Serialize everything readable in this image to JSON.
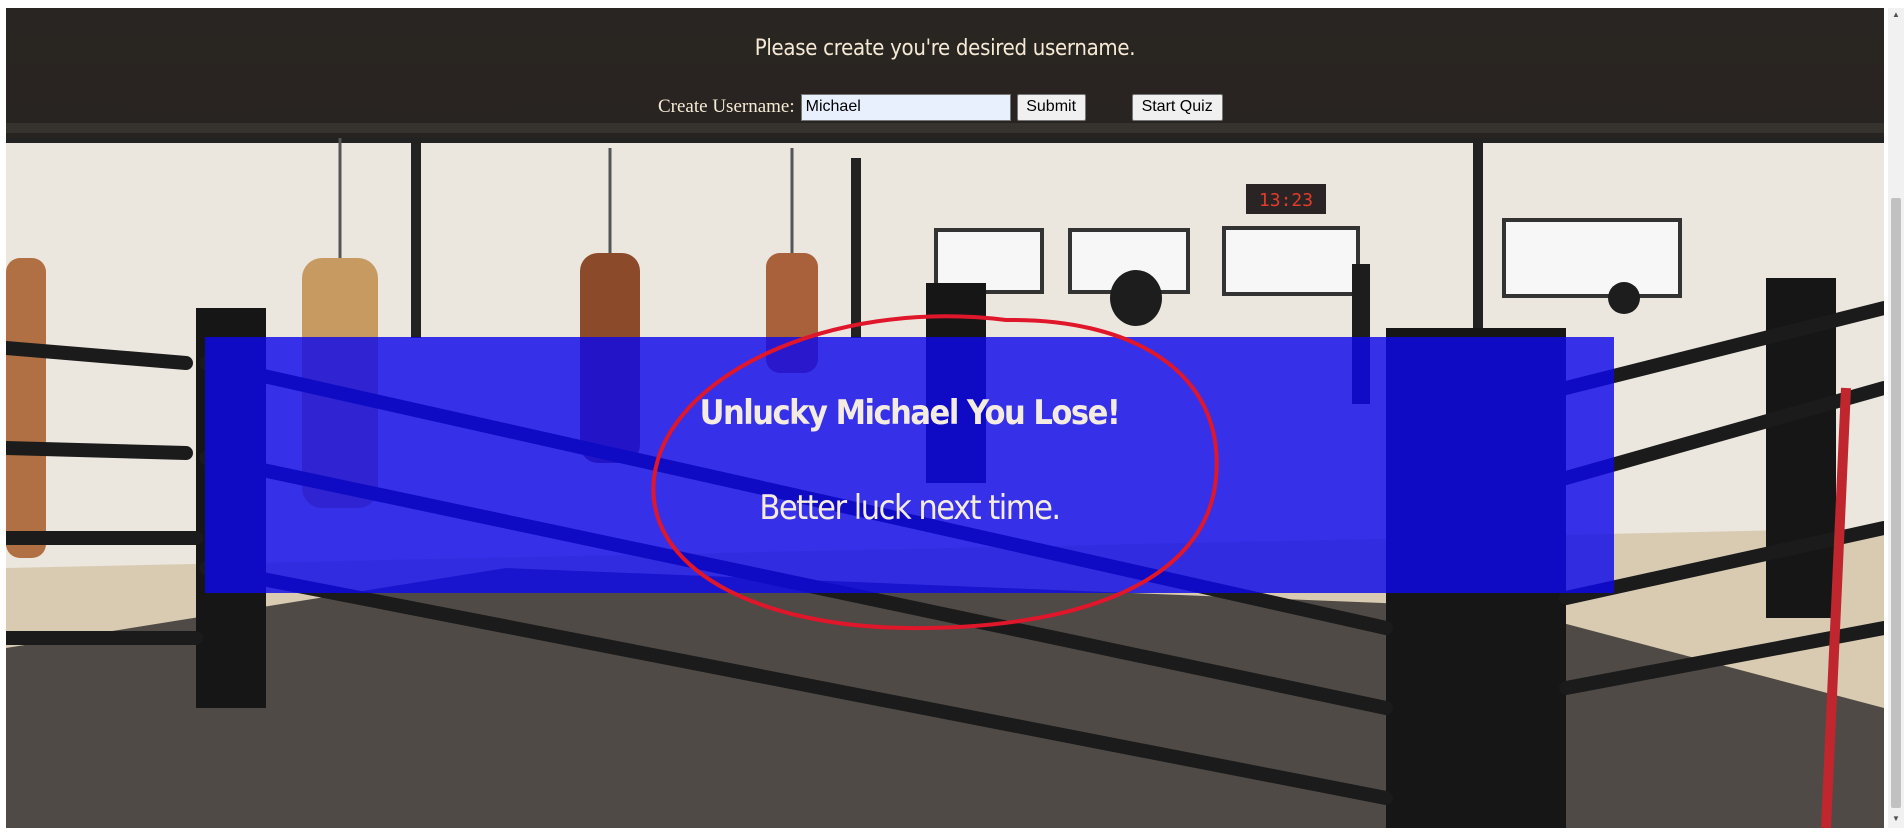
{
  "header": {
    "title": "Please create you're desired username.",
    "username_label": "Create Username:",
    "username_value": "Michael",
    "submit_label": "Submit",
    "start_quiz_label": "Start Quiz"
  },
  "result": {
    "title": "Unlucky Michael You Lose!",
    "subtitle": "Better luck next time."
  },
  "scene": {
    "clock_text": "13:23"
  },
  "colors": {
    "panel": "#0e08eb",
    "annotation": "#e0162b",
    "header_text": "#f6ead6"
  }
}
